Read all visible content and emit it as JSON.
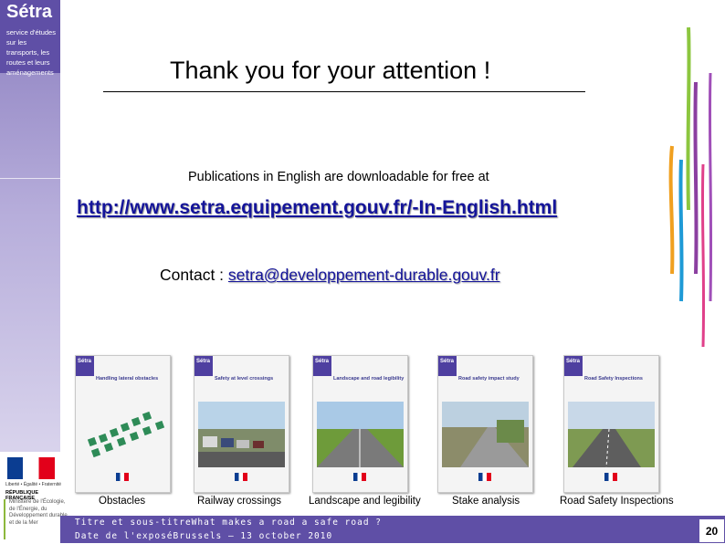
{
  "brand": {
    "name": "Sétra",
    "tagline": "service d'études sur les transports, les routes et leurs aménagements"
  },
  "slide": {
    "title": "Thank you for your attention !",
    "intro": "Publications in English are downloadable for free at",
    "link": "http://www.setra.equipement.gouv.fr/-In-English.html",
    "contact_label": "Contact : ",
    "contact_email": "setra@developpement-durable.gouv.fr"
  },
  "publications": [
    {
      "caption": "Obstacles",
      "cover_title": "Handling lateral obstacles"
    },
    {
      "caption": "Railway crossings",
      "cover_title": "Safety at level crossings"
    },
    {
      "caption": "Landscape and legibility",
      "cover_title": "Landscape and road legibility"
    },
    {
      "caption": "Stake analysis",
      "cover_title": "Road safety impact study"
    },
    {
      "caption": "Road Safety Inspections",
      "cover_title": "Road Safety Inspections"
    }
  ],
  "logo": {
    "motto": "Liberté • Égalité • Fraternité",
    "republique": "RÉPUBLIQUE FRANÇAISE",
    "ministry": "Ministère de l'Écologie, de l'Énergie, du Développement durable et de la Mer"
  },
  "footer": {
    "line1": "Titre et sous-titreWhat makes a road a safe road ?",
    "line2": "Date de l'exposéBrussels – 13 october 2010",
    "page": "20"
  },
  "colors": {
    "brand_purple": "#5f4fa6",
    "link_blue": "#14149a"
  }
}
